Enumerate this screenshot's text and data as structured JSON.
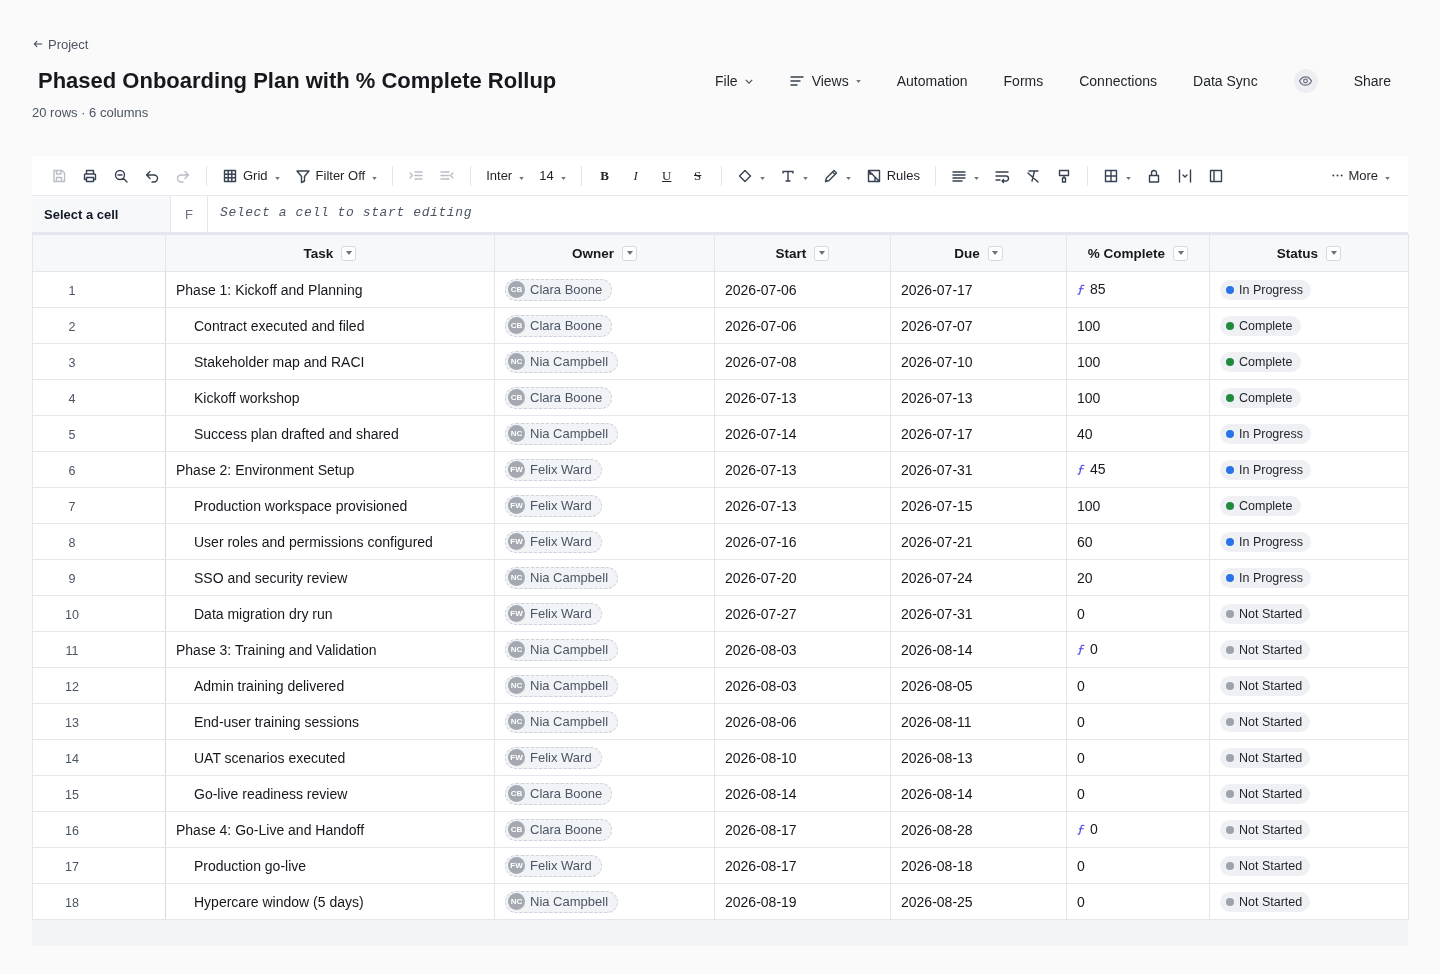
{
  "back_link": "Project",
  "title": "Phased Onboarding Plan with % Complete Rollup",
  "summary": "20 rows · 6 columns",
  "menus": [
    {
      "label": "File",
      "kind": "dropdown"
    },
    {
      "label": "Views",
      "kind": "view_menu"
    },
    {
      "label": "Automation",
      "kind": "link"
    },
    {
      "label": "Forms",
      "kind": "link"
    },
    {
      "label": "Connections",
      "kind": "link"
    },
    {
      "label": "Data Sync",
      "kind": "link"
    }
  ],
  "share_button": {
    "label": "Share"
  },
  "toolbar": {
    "file_actions": [
      {
        "kind": "save",
        "disabled": true
      },
      {
        "kind": "print",
        "disabled": false
      },
      {
        "kind": "zoom_out",
        "disabled": false
      },
      {
        "kind": "undo",
        "disabled": false
      },
      {
        "kind": "redo",
        "disabled": true
      }
    ],
    "view_button": {
      "label": "Grid"
    },
    "filter_button": {
      "label": "Filter Off"
    },
    "indent_actions": [
      {
        "kind": "indent",
        "disabled": true
      },
      {
        "kind": "outdent",
        "disabled": true
      }
    ],
    "font_family": "Inter",
    "font_size": "14",
    "format_buttons": [
      {
        "kind": "bold",
        "label": "B"
      },
      {
        "kind": "italic",
        "label": "I"
      },
      {
        "kind": "underline",
        "label": "U"
      },
      {
        "kind": "strike",
        "label": "S"
      }
    ],
    "rules_button": {
      "label": "Rules"
    },
    "more_button": {
      "label": "More"
    }
  },
  "formula_bar": {
    "cell_ref": "Select a cell",
    "fx_label": "F",
    "placeholder": "Select a cell to start editing"
  },
  "table": {
    "columns": [
      {
        "label": "Task"
      },
      {
        "label": "Owner"
      },
      {
        "label": "Start"
      },
      {
        "label": "Due"
      },
      {
        "label": "% Complete"
      },
      {
        "label": "Status"
      }
    ],
    "rows": [
      {
        "number": "1",
        "task": "Phase 1: Kickoff and Planning",
        "owner": {
          "initials": "CB",
          "name": "Clara Boone"
        },
        "start": "2026-07-06",
        "due": "2026-07-17",
        "complete": {
          "rollup": true,
          "value": "85"
        },
        "status": {
          "label": "In Progress",
          "color": "#2b72e6"
        },
        "children": [
          {
            "number": "2",
            "task": "Contract executed and filed",
            "owner": {
              "initials": "CB",
              "name": "Clara Boone"
            },
            "start": "2026-07-06",
            "due": "2026-07-07",
            "complete": {
              "rollup": false,
              "value": "100"
            },
            "status": {
              "label": "Complete",
              "color": "#1f8a3f"
            }
          },
          {
            "number": "3",
            "task": "Stakeholder map and RACI",
            "owner": {
              "initials": "NC",
              "name": "Nia Campbell"
            },
            "start": "2026-07-08",
            "due": "2026-07-10",
            "complete": {
              "rollup": false,
              "value": "100"
            },
            "status": {
              "label": "Complete",
              "color": "#1f8a3f"
            }
          },
          {
            "number": "4",
            "task": "Kickoff workshop",
            "owner": {
              "initials": "CB",
              "name": "Clara Boone"
            },
            "start": "2026-07-13",
            "due": "2026-07-13",
            "complete": {
              "rollup": false,
              "value": "100"
            },
            "status": {
              "label": "Complete",
              "color": "#1f8a3f"
            }
          },
          {
            "number": "5",
            "task": "Success plan drafted and shared",
            "owner": {
              "initials": "NC",
              "name": "Nia Campbell"
            },
            "start": "2026-07-14",
            "due": "2026-07-17",
            "complete": {
              "rollup": false,
              "value": "40"
            },
            "status": {
              "label": "In Progress",
              "color": "#2b72e6"
            }
          }
        ]
      },
      {
        "number": "6",
        "task": "Phase 2: Environment Setup",
        "owner": {
          "initials": "FW",
          "name": "Felix Ward"
        },
        "start": "2026-07-13",
        "due": "2026-07-31",
        "complete": {
          "rollup": true,
          "value": "45"
        },
        "status": {
          "label": "In Progress",
          "color": "#2b72e6"
        },
        "children": [
          {
            "number": "7",
            "task": "Production workspace provisioned",
            "owner": {
              "initials": "FW",
              "name": "Felix Ward"
            },
            "start": "2026-07-13",
            "due": "2026-07-15",
            "complete": {
              "rollup": false,
              "value": "100"
            },
            "status": {
              "label": "Complete",
              "color": "#1f8a3f"
            }
          },
          {
            "number": "8",
            "task": "User roles and permissions configured",
            "owner": {
              "initials": "FW",
              "name": "Felix Ward"
            },
            "start": "2026-07-16",
            "due": "2026-07-21",
            "complete": {
              "rollup": false,
              "value": "60"
            },
            "status": {
              "label": "In Progress",
              "color": "#2b72e6"
            }
          },
          {
            "number": "9",
            "task": "SSO and security review",
            "owner": {
              "initials": "NC",
              "name": "Nia Campbell"
            },
            "start": "2026-07-20",
            "due": "2026-07-24",
            "complete": {
              "rollup": false,
              "value": "20"
            },
            "status": {
              "label": "In Progress",
              "color": "#2b72e6"
            }
          },
          {
            "number": "10",
            "task": "Data migration dry run",
            "owner": {
              "initials": "FW",
              "name": "Felix Ward"
            },
            "start": "2026-07-27",
            "due": "2026-07-31",
            "complete": {
              "rollup": false,
              "value": "0"
            },
            "status": {
              "label": "Not Started",
              "color": "#9ca3af"
            }
          }
        ]
      },
      {
        "number": "11",
        "task": "Phase 3: Training and Validation",
        "owner": {
          "initials": "NC",
          "name": "Nia Campbell"
        },
        "start": "2026-08-03",
        "due": "2026-08-14",
        "complete": {
          "rollup": true,
          "value": "0"
        },
        "status": {
          "label": "Not Started",
          "color": "#9ca3af"
        },
        "children": [
          {
            "number": "12",
            "task": "Admin training delivered",
            "owner": {
              "initials": "NC",
              "name": "Nia Campbell"
            },
            "start": "2026-08-03",
            "due": "2026-08-05",
            "complete": {
              "rollup": false,
              "value": "0"
            },
            "status": {
              "label": "Not Started",
              "color": "#9ca3af"
            }
          },
          {
            "number": "13",
            "task": "End-user training sessions",
            "owner": {
              "initials": "NC",
              "name": "Nia Campbell"
            },
            "start": "2026-08-06",
            "due": "2026-08-11",
            "complete": {
              "rollup": false,
              "value": "0"
            },
            "status": {
              "label": "Not Started",
              "color": "#9ca3af"
            }
          },
          {
            "number": "14",
            "task": "UAT scenarios executed",
            "owner": {
              "initials": "FW",
              "name": "Felix Ward"
            },
            "start": "2026-08-10",
            "due": "2026-08-13",
            "complete": {
              "rollup": false,
              "value": "0"
            },
            "status": {
              "label": "Not Started",
              "color": "#9ca3af"
            }
          },
          {
            "number": "15",
            "task": "Go-live readiness review",
            "owner": {
              "initials": "CB",
              "name": "Clara Boone"
            },
            "start": "2026-08-14",
            "due": "2026-08-14",
            "complete": {
              "rollup": false,
              "value": "0"
            },
            "status": {
              "label": "Not Started",
              "color": "#9ca3af"
            }
          }
        ]
      },
      {
        "number": "16",
        "task": "Phase 4: Go-Live and Handoff",
        "owner": {
          "initials": "CB",
          "name": "Clara Boone"
        },
        "start": "2026-08-17",
        "due": "2026-08-28",
        "complete": {
          "rollup": true,
          "value": "0"
        },
        "status": {
          "label": "Not Started",
          "color": "#9ca3af"
        },
        "children": [
          {
            "number": "17",
            "task": "Production go-live",
            "owner": {
              "initials": "FW",
              "name": "Felix Ward"
            },
            "start": "2026-08-17",
            "due": "2026-08-18",
            "complete": {
              "rollup": false,
              "value": "0"
            },
            "status": {
              "label": "Not Started",
              "color": "#9ca3af"
            }
          },
          {
            "number": "18",
            "task": "Hypercare window (5 days)",
            "owner": {
              "initials": "NC",
              "name": "Nia Campbell"
            },
            "start": "2026-08-19",
            "due": "2026-08-25",
            "complete": {
              "rollup": false,
              "value": "0"
            },
            "status": {
              "label": "Not Started",
              "color": "#9ca3af"
            }
          }
        ]
      }
    ]
  }
}
